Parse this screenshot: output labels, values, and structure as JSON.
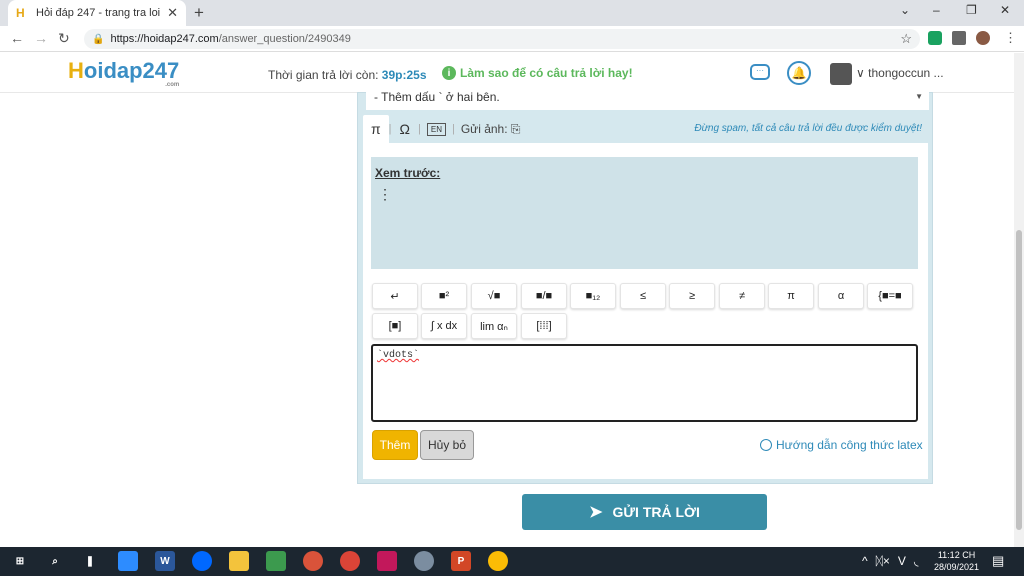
{
  "browser": {
    "tab_title": "Hỏi đáp 247 - trang tra loi",
    "tab_close": "✕",
    "new_tab": "+",
    "url_host": "https://hoidap247.com",
    "url_path": "/answer_question/2490349",
    "window_buttons": [
      "⌄",
      "–",
      "❐",
      "✕"
    ]
  },
  "header": {
    "logo_h": "H",
    "logo_rest": "oidap247",
    "logo_sub": ".com",
    "timer_label": "Thời gian trả lời còn:",
    "timer_value": "39p:25s",
    "tip": "Làm sao để có câu trả lời hay!",
    "username": "thongoccun ..."
  },
  "editor": {
    "preview_line": "- Thêm dấu ` ở hai bên.",
    "tools": [
      "π",
      "Ω",
      "EN"
    ],
    "upload_label": "Gửi ảnh:",
    "warning": "Đừng spam, tất cả câu trả lời đều được kiểm duyệt!",
    "preview_label": "Xem trước:",
    "preview_value": "⋮",
    "keys_row1": [
      "↵",
      "■²",
      "√■",
      "■/■",
      "■₁₂",
      "≤",
      "≥",
      "≠",
      "π",
      "α",
      "{■=■"
    ],
    "keys_row2": [
      "[■]",
      "∫ x dx",
      "lim αₙ",
      "[⁞⁞⁞]"
    ],
    "input_value": "`vdots`",
    "add_label": "Thêm",
    "cancel_label": "Hủy bỏ",
    "latex_help": "Hướng dẫn công thức latex",
    "submit_label": "GỬI TRẢ LỜI"
  },
  "taskbar": {
    "tray": [
      "^",
      "ᛞ×",
      "V",
      "◟"
    ],
    "time": "11:12 CH",
    "date": "28/09/2021"
  },
  "colors": {
    "brand_blue": "#3a8ec4",
    "brand_yellow": "#e8b010",
    "submit": "#3a8ea6",
    "add_button": "#f0b400",
    "tip_green": "#5cb85c"
  }
}
